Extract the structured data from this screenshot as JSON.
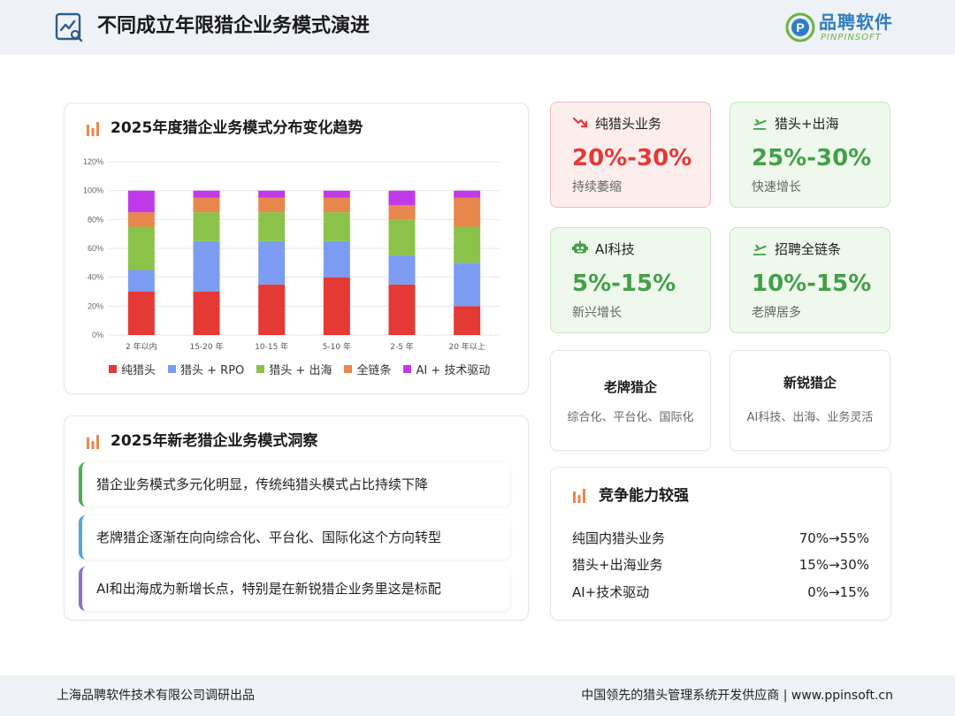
{
  "header": {
    "title": "不同成立年限猎企业务模式演进",
    "logo_cn": "品聘软件",
    "logo_en": "PINPINSOFT"
  },
  "chart_card": {
    "title": "2025年度猎企业务模式分布变化趋势"
  },
  "chart_data": {
    "type": "bar",
    "stacked": true,
    "categories": [
      "2 年以内",
      "15-20 年",
      "10-15 年",
      "5-10 年",
      "2-5 年",
      "20 年以上"
    ],
    "series": [
      {
        "name": "纯猎头",
        "color": "#e53935",
        "values": [
          30,
          30,
          35,
          40,
          35,
          20
        ]
      },
      {
        "name": "猎头 + RPO",
        "color": "#7b9cf2",
        "values": [
          15,
          35,
          30,
          25,
          20,
          30
        ]
      },
      {
        "name": "猎头 + 出海",
        "color": "#8bc34a",
        "values": [
          30,
          20,
          20,
          20,
          25,
          25
        ]
      },
      {
        "name": "全链条",
        "color": "#e8874c",
        "values": [
          10,
          10,
          10,
          10,
          10,
          20
        ]
      },
      {
        "name": "AI + 技术驱动",
        "color": "#c03ae8",
        "values": [
          15,
          5,
          5,
          5,
          10,
          5
        ]
      }
    ],
    "y_ticks": [
      "0%",
      "20%",
      "40%",
      "60%",
      "80%",
      "100%",
      "120%"
    ],
    "ylim": [
      0,
      120
    ],
    "grid": true,
    "legend": "bottom"
  },
  "insight_card": {
    "title": "2025年新老猎企业务模式洞察",
    "items": [
      {
        "text": "猎企业务模式多元化明显，传统纯猎头模式占比持续下降",
        "color": "#4caf50"
      },
      {
        "text": "老牌猎企逐渐在向向综合化、平台化、国际化这个方向转型",
        "color": "#4fa7dc"
      },
      {
        "text": "AI和出海成为新增长点，特别是在新锐猎企业务里这是标配",
        "color": "#8e6bd6"
      }
    ]
  },
  "stats": [
    {
      "title": "纯猎头业务",
      "value": "20%-30%",
      "desc": "持续萎缩",
      "icon": "trend-down-icon",
      "value_color": "#e53935",
      "bg": "#fdeeee",
      "border": "#f3b8b8"
    },
    {
      "title": "猎头+出海",
      "value": "25%-30%",
      "desc": "快速增长",
      "icon": "airplane-icon",
      "value_color": "#43a047",
      "bg": "#eef8ec",
      "border": "#c8e6c2"
    },
    {
      "title": "AI科技",
      "value": "5%-15%",
      "desc": "新兴增长",
      "icon": "robot-icon",
      "value_color": "#43a047",
      "bg": "#eef8ec",
      "border": "#c8e6c2"
    },
    {
      "title": "招聘全链条",
      "value": "10%-15%",
      "desc": "老牌居多",
      "icon": "airplane-icon",
      "value_color": "#43a047",
      "bg": "#eef8ec",
      "border": "#c8e6c2"
    }
  ],
  "types": [
    {
      "title": "老牌猎企",
      "desc": "综合化、平台化、国际化"
    },
    {
      "title": "新锐猎企",
      "desc": "AI科技、出海、业务灵活"
    }
  ],
  "competition": {
    "title": "竞争能力较强",
    "rows": [
      {
        "label": "纯国内猎头业务",
        "value": "70%→55%"
      },
      {
        "label": "猎头+出海业务",
        "value": "15%→30%"
      },
      {
        "label": "AI+技术驱动",
        "value": "0%→15%"
      }
    ]
  },
  "footer": {
    "left": "上海品聘软件技术有限公司调研出品",
    "right": "中国领先的猎头管理系统开发供应商 |  www.ppinsoft.cn"
  },
  "colors": {
    "accent_blue": "#2f7cc0",
    "accent_green": "#6db33f",
    "title_icon": "#e8874c"
  }
}
